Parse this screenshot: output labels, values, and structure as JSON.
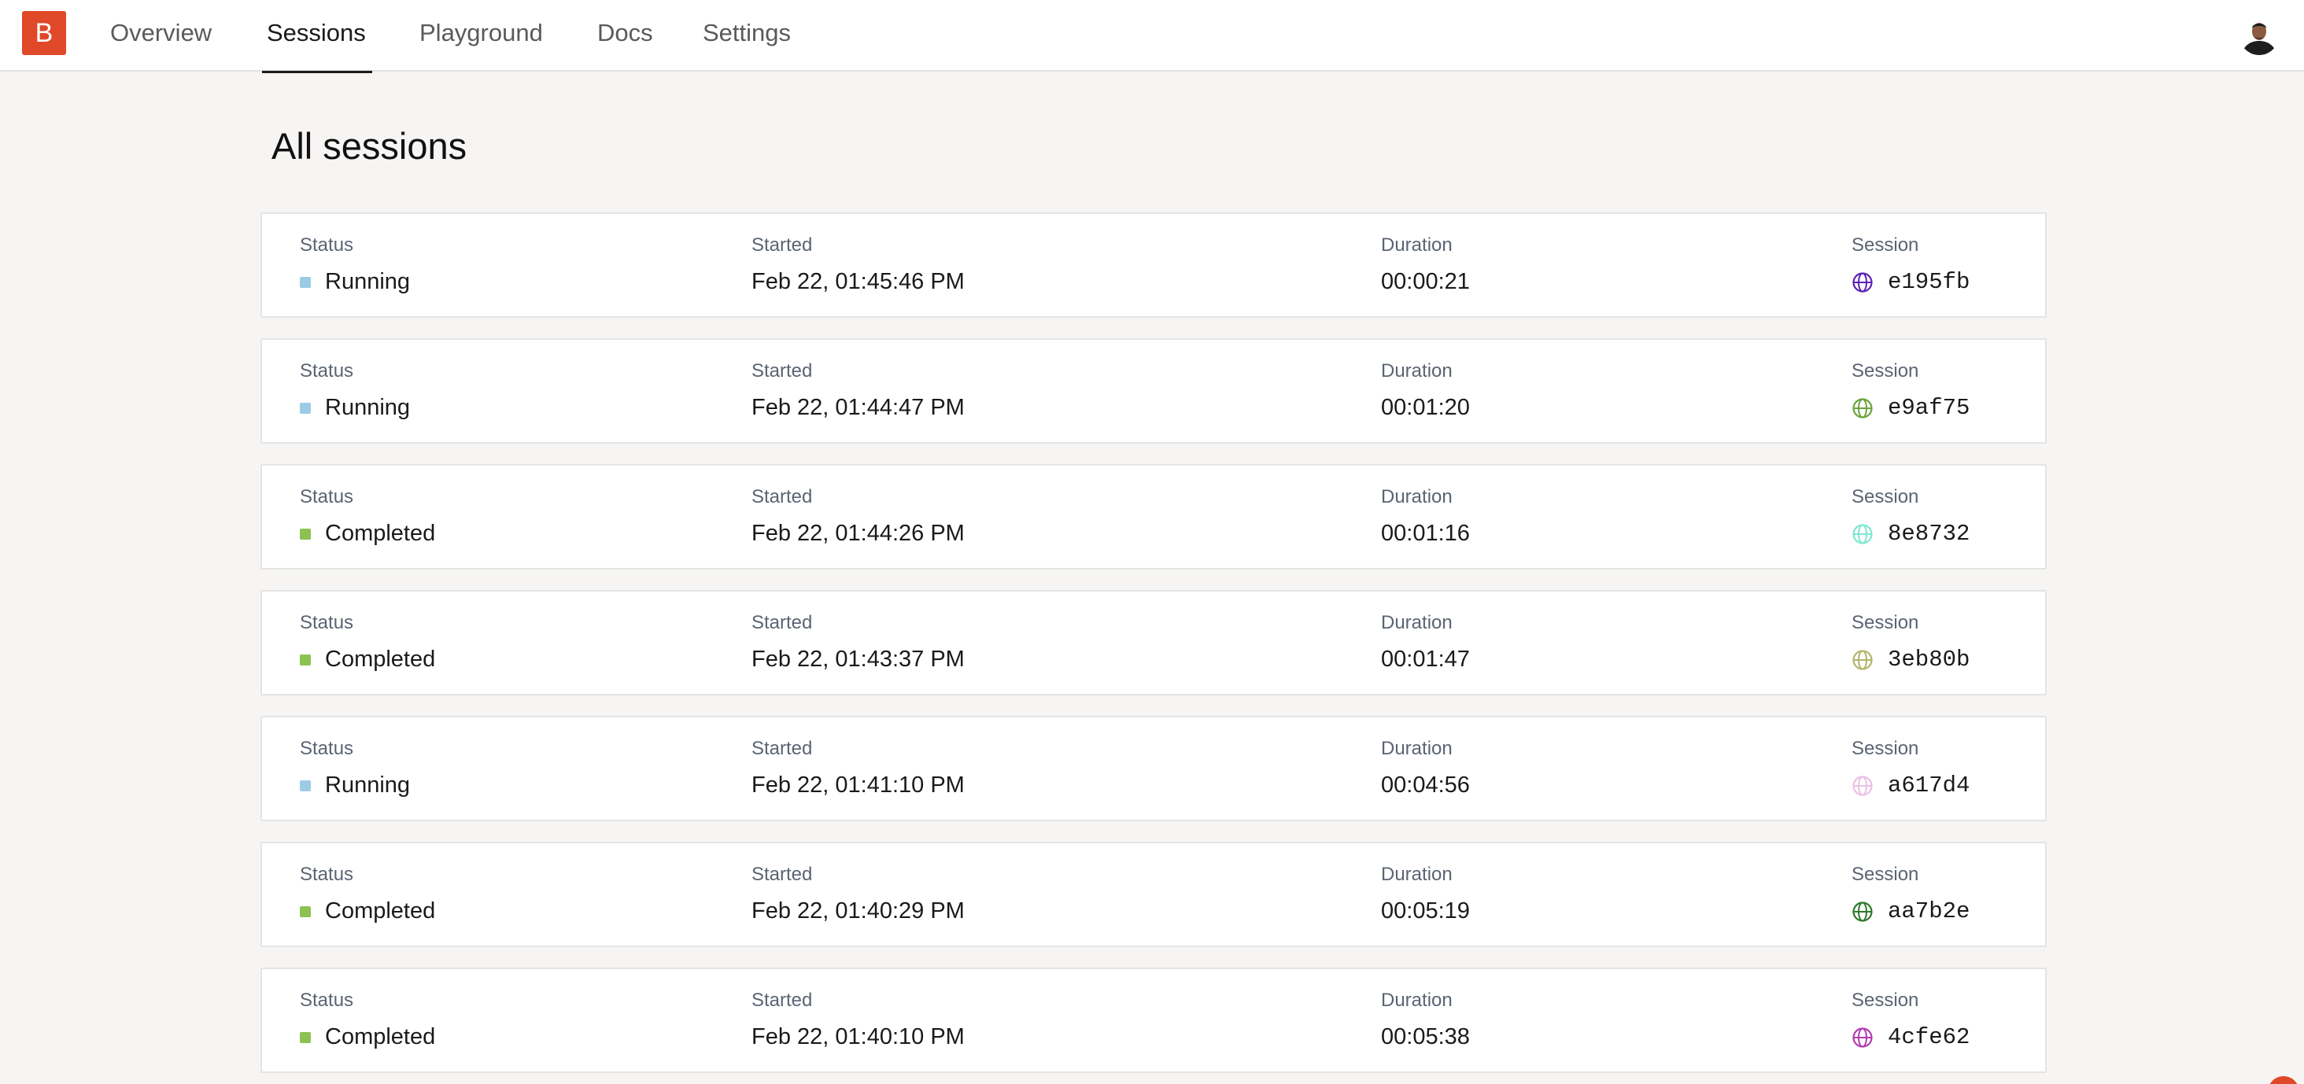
{
  "app": {
    "logo_letter": "B",
    "brand_color": "#e0482a"
  },
  "nav": {
    "items": [
      {
        "label": "Overview",
        "active": false
      },
      {
        "label": "Sessions",
        "active": true
      },
      {
        "label": "Playground",
        "active": false
      },
      {
        "label": "Docs",
        "active": false
      },
      {
        "label": "Settings",
        "active": false
      }
    ]
  },
  "page": {
    "title": "All sessions"
  },
  "columns": {
    "status": "Status",
    "started": "Started",
    "duration": "Duration",
    "session": "Session"
  },
  "status_colors": {
    "Running": "#9ccbe6",
    "Completed": "#8dc152"
  },
  "sessions": [
    {
      "status": "Running",
      "started": "Feb 22, 01:45:46 PM",
      "duration": "00:00:21",
      "id": "e195fb",
      "icon": "globe-icon",
      "icon_color": "#5b21b6"
    },
    {
      "status": "Running",
      "started": "Feb 22, 01:44:47 PM",
      "duration": "00:01:20",
      "id": "e9af75",
      "icon": "globe-icon",
      "icon_color": "#6aa33a"
    },
    {
      "status": "Completed",
      "started": "Feb 22, 01:44:26 PM",
      "duration": "00:01:16",
      "id": "8e8732",
      "icon": "globe-icon",
      "icon_color": "#7fe8d2"
    },
    {
      "status": "Completed",
      "started": "Feb 22, 01:43:37 PM",
      "duration": "00:01:47",
      "id": "3eb80b",
      "icon": "globe-icon",
      "icon_color": "#b3b56a"
    },
    {
      "status": "Running",
      "started": "Feb 22, 01:41:10 PM",
      "duration": "00:04:56",
      "id": "a617d4",
      "icon": "globe-icon",
      "icon_color": "#ecc0e6"
    },
    {
      "status": "Completed",
      "started": "Feb 22, 01:40:29 PM",
      "duration": "00:05:19",
      "id": "aa7b2e",
      "icon": "globe-icon",
      "icon_color": "#2f7a2c"
    },
    {
      "status": "Completed",
      "started": "Feb 22, 01:40:10 PM",
      "duration": "00:05:38",
      "id": "4cfe62",
      "icon": "globe-icon",
      "icon_color": "#b23bb0"
    }
  ]
}
